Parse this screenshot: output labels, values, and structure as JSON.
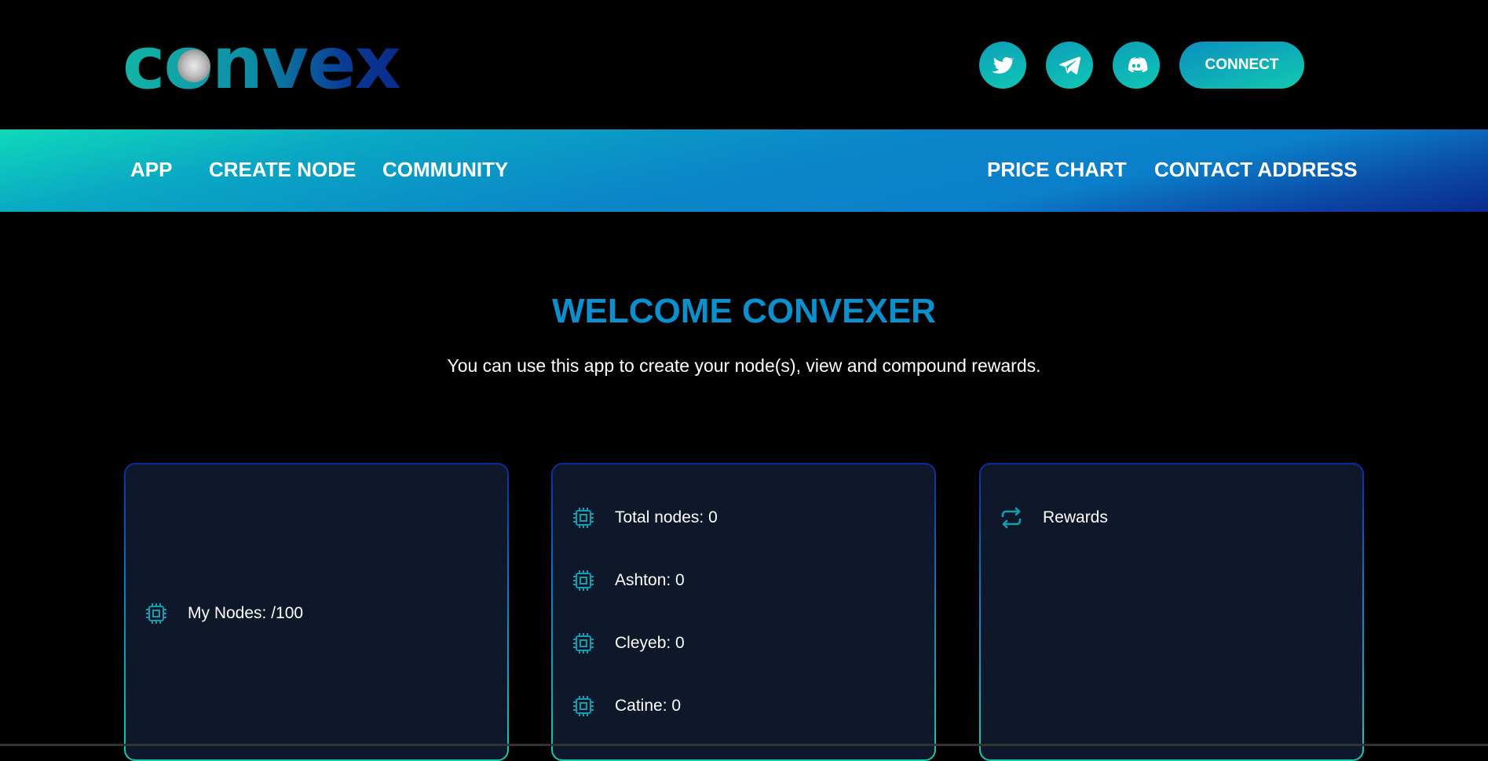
{
  "header": {
    "logo_text": "convex",
    "social": [
      {
        "name": "twitter-icon"
      },
      {
        "name": "telegram-icon"
      },
      {
        "name": "discord-icon"
      }
    ],
    "connect_label": "CONNECT"
  },
  "nav": {
    "left": [
      "APP",
      "CREATE NODE",
      "COMMUNITY"
    ],
    "right": [
      "PRICE CHART",
      "CONTACT ADDRESS"
    ]
  },
  "main": {
    "title": "WELCOME CONVEXER",
    "subtitle": "You can use this app to create your node(s), view and compound rewards."
  },
  "cards": {
    "my_nodes": {
      "label": "My Nodes: /100"
    },
    "totals": {
      "items": [
        "Total nodes: 0",
        "Ashton: 0",
        "Cleyeb: 0",
        "Catine: 0"
      ]
    },
    "rewards": {
      "label": "Rewards"
    }
  },
  "colors": {
    "accent": "#0a90cc",
    "teal": "#10c7b4",
    "card_bg": "#0f172a",
    "icon": "#0f9fae"
  }
}
